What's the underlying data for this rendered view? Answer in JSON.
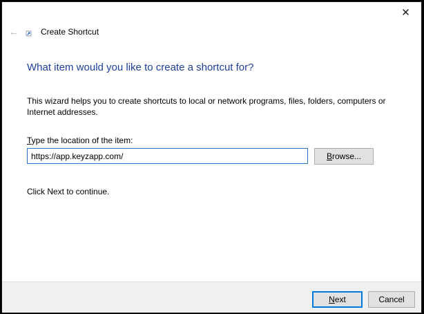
{
  "titlebar": {
    "close_icon": "close-icon"
  },
  "header": {
    "back_icon": "back-arrow-icon",
    "app_icon": "shortcut-icon",
    "title": "Create Shortcut"
  },
  "main": {
    "heading": "What item would you like to create a shortcut for?",
    "description": "This wizard helps you to create shortcuts to local or network programs, files, folders, computers or Internet addresses.",
    "location_label_mnemonic": "T",
    "location_label_rest": "ype the location of the item:",
    "location_value": "https://app.keyzapp.com/",
    "browse_mnemonic": "B",
    "browse_rest": "rowse...",
    "hint": "Click Next to continue."
  },
  "footer": {
    "next_mnemonic": "N",
    "next_rest": "ext",
    "cancel_label": "Cancel"
  },
  "colors": {
    "heading": "#1f3f99",
    "focus_border": "#2b73c9",
    "button_bg": "#e1e1e1",
    "footer_bg": "#f0f0f0"
  }
}
